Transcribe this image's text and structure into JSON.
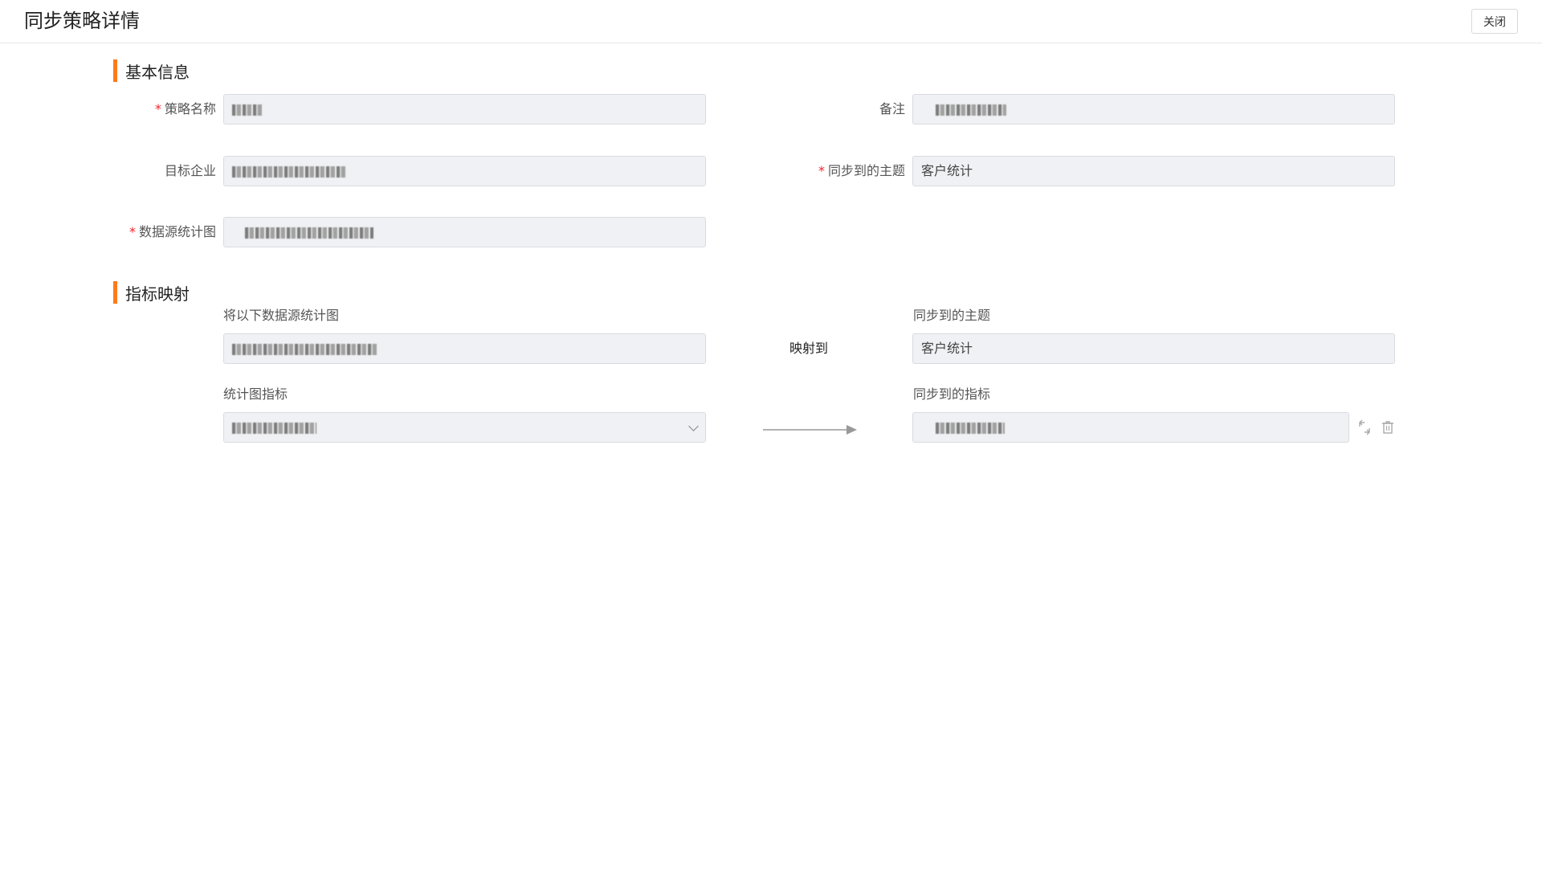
{
  "header": {
    "title": "同步策略详情",
    "close_label": "关闭"
  },
  "basic_info": {
    "section_title": "基本信息",
    "strategy_name": {
      "label": "策略名称",
      "required": "*"
    },
    "remark": {
      "label": "备注"
    },
    "target_company": {
      "label": "目标企业"
    },
    "sync_topic": {
      "label": "同步到的主题",
      "required": "*",
      "value": "客户统计"
    },
    "data_source_chart": {
      "label": "数据源统计图",
      "required": "*"
    }
  },
  "mapping": {
    "section_title": "指标映射",
    "source_chart_label": "将以下数据源统计图",
    "map_to_label": "映射到",
    "target_topic_label": "同步到的主题",
    "target_topic_value": "客户统计",
    "chart_metric_label": "统计图指标",
    "target_metric_label": "同步到的指标"
  },
  "icons": {
    "chevron": "chevron-down-icon",
    "arrow": "arrow-right-icon",
    "switch": "switch-icon",
    "delete": "trash-icon"
  }
}
